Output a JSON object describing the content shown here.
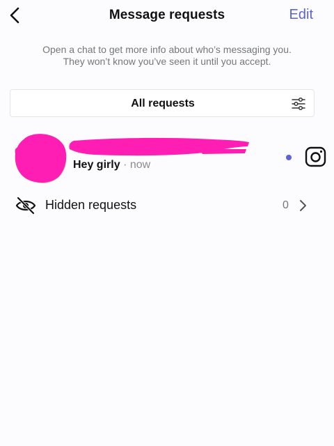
{
  "header": {
    "title": "Message requests",
    "edit_label": "Edit",
    "back_icon": "chevron-left-icon"
  },
  "info": {
    "line1": "Open a chat to get more info about who’s messaging you.",
    "line2": "They won’t know you’ve seen it until you accept."
  },
  "filter": {
    "label": "All requests",
    "icon": "sliders-icon"
  },
  "requests": [
    {
      "preview": "Hey girly",
      "time": "· now",
      "unread": true,
      "action_icon": "camera-icon"
    }
  ],
  "hidden_requests": {
    "label": "Hidden requests",
    "count": "0",
    "icon": "eye-off-icon"
  },
  "colors": {
    "accent": "#5a63d8",
    "redaction": "#ff1eb4",
    "secondary_text": "#74767c",
    "background": "#fcfcfe"
  }
}
